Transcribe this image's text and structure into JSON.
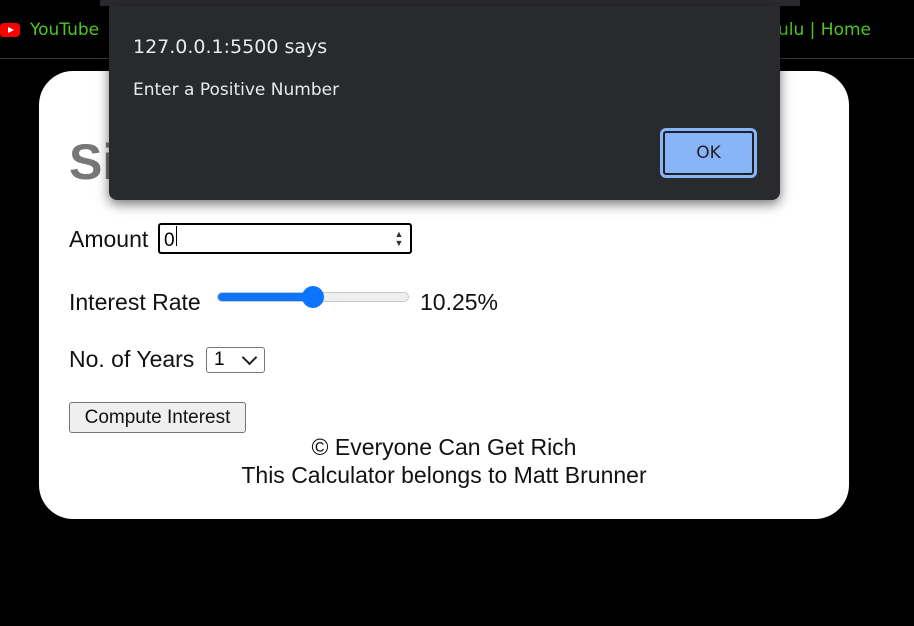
{
  "bookmarks": {
    "youtube": {
      "label": "YouTube",
      "icon": "youtube-icon"
    },
    "hulu": {
      "label": "ulu | Home"
    }
  },
  "calculator": {
    "title": "Si",
    "amount_label": "Amount",
    "amount_value": "0",
    "rate_label": "Interest Rate",
    "rate_value": "10.25%",
    "rate_fraction": 0.5,
    "years_label": "No. of Years",
    "years_selected": "1",
    "compute_button_label": "Compute Interest",
    "footer_line_1": "© Everyone Can Get Rich",
    "footer_line_2": "This Calculator belongs to Matt Brunner"
  },
  "dialog": {
    "title": "127.0.0.1:5500 says",
    "message": "Enter a Positive Number",
    "ok_label": "OK"
  },
  "colors": {
    "bookmark_text": "#4ec726",
    "slider_accent": "#0b75ff",
    "dialog_bg": "#292a2d",
    "ok_button_bg": "#8ab4f8"
  }
}
